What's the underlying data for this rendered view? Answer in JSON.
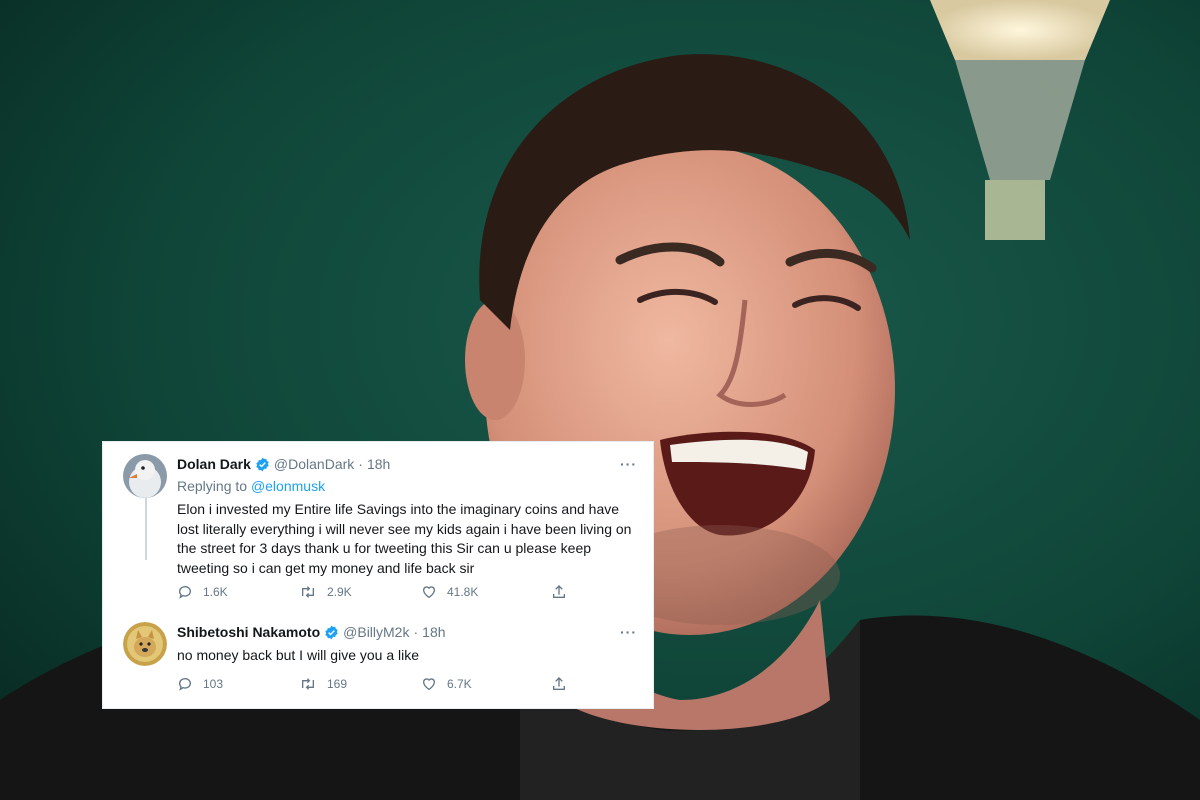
{
  "tweets": [
    {
      "author_name": "Dolan Dark",
      "handle": "@DolanDark",
      "separator": "·",
      "time": "18h",
      "reply_prefix": "Replying to",
      "reply_to": "@elonmusk",
      "text": "Elon i invested my Entire life Savings into the imaginary coins and have lost literally everything i will never see my kids again i have been living on the street for 3 days thank u for tweeting this Sir can u please keep tweeting so i can get my money and life back sir",
      "more_label": "···",
      "replies": "1.6K",
      "retweets": "2.9K",
      "likes": "41.8K",
      "avatar_icon": "duck-avatar-icon"
    },
    {
      "author_name": "Shibetoshi Nakamoto",
      "handle": "@BillyM2k",
      "separator": "·",
      "time": "18h",
      "text": "no money back but I will give you a like",
      "more_label": "···",
      "replies": "103",
      "retweets": "169",
      "likes": "6.7K",
      "avatar_icon": "doge-coin-avatar-icon"
    }
  ],
  "colors": {
    "verified_blue": "#1da1f2",
    "mention_blue": "#1da1f2",
    "secondary_text": "#657786",
    "primary_text": "#14171a",
    "background_green": "#0d3d33"
  }
}
